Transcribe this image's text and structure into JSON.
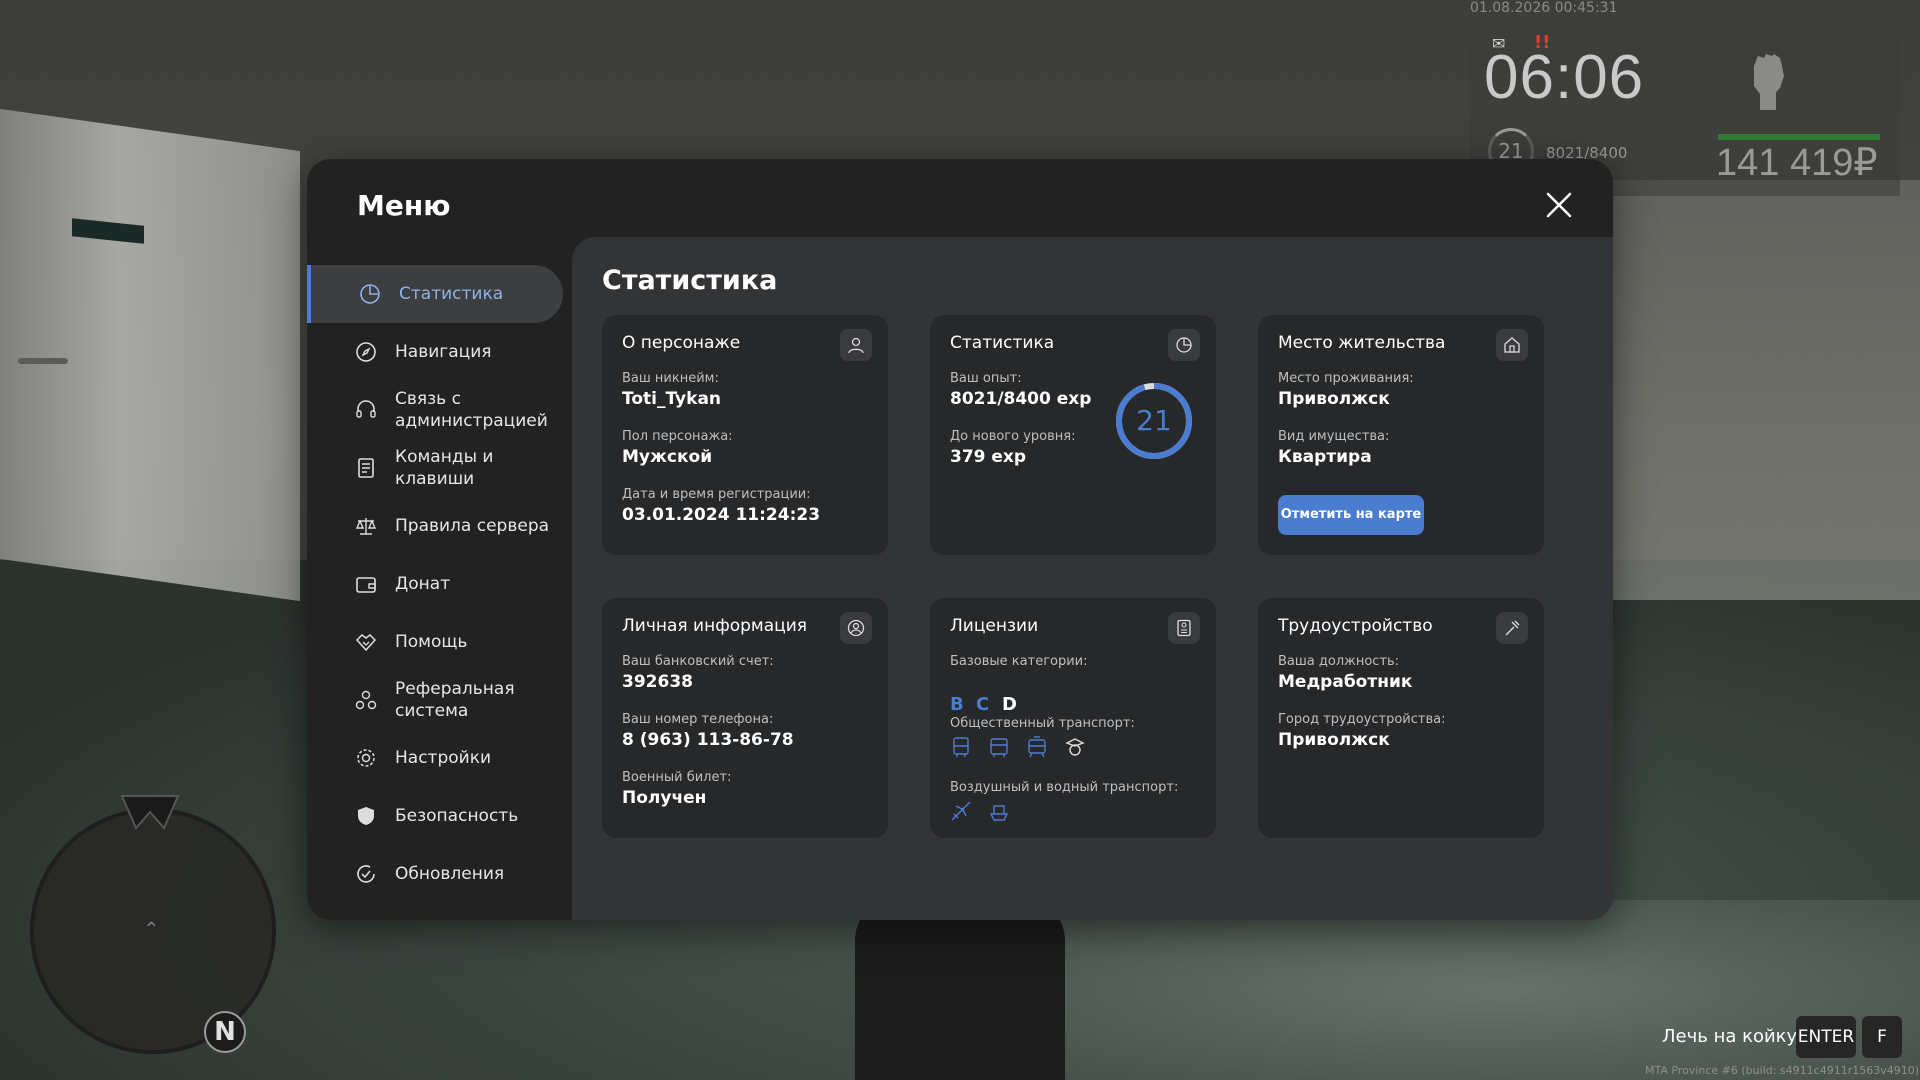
{
  "hud": {
    "datetime": "01.08.2026 00:45:31",
    "time": "06:06",
    "level": "21",
    "exp": "8021/8400",
    "money": "141 419₽",
    "mail_icon": "mail-icon",
    "alert_icon": "alert-icon",
    "colors": {
      "health": "#2e7d32",
      "alert": "#e53935"
    }
  },
  "minimap": {
    "north_label": "N"
  },
  "prompt": {
    "text": "Лечь на койку",
    "key_enter": "ENTER",
    "key_f": "F"
  },
  "build": "MTA Province #6 (build: s4911c4911r1563v4910)",
  "menu": {
    "title": "Меню",
    "sidebar": [
      {
        "label": "Статистика",
        "icon": "pie-chart-icon",
        "active": true
      },
      {
        "label": "Навигация",
        "icon": "compass-icon"
      },
      {
        "label": "Связь с администрацией",
        "icon": "headset-icon"
      },
      {
        "label": "Команды и клавиши",
        "icon": "document-icon"
      },
      {
        "label": "Правила сервера",
        "icon": "scales-icon"
      },
      {
        "label": "Донат",
        "icon": "wallet-icon"
      },
      {
        "label": "Помощь",
        "icon": "handshake-icon"
      },
      {
        "label": "Реферальная система",
        "icon": "referral-icon"
      },
      {
        "label": "Настройки",
        "icon": "gear-icon"
      },
      {
        "label": "Безопасность",
        "icon": "shield-icon"
      },
      {
        "label": "Обновления",
        "icon": "refresh-check-icon"
      }
    ],
    "content": {
      "title": "Статистика",
      "about": {
        "title": "О персонаже",
        "nickname_label": "Ваш никнейм:",
        "nickname": "Toti_Tykan",
        "gender_label": "Пол персонажа:",
        "gender": "Мужской",
        "reg_label": "Дата и время регистрации:",
        "reg_date": "03.01.2024 11:24:23"
      },
      "stats": {
        "title": "Статистика",
        "exp_label": "Ваш опыт:",
        "exp": "8021/8400 exp",
        "next_label": "До нового уровня:",
        "next": "379 exp",
        "level": "21",
        "level_progress": 0.955
      },
      "residence": {
        "title": "Место жительства",
        "place_label": "Место проживания:",
        "place": "Приволжск",
        "property_label": "Вид имущества:",
        "property": "Квартира",
        "button": "Отметить на карте"
      },
      "personal": {
        "title": "Личная информация",
        "bank_label": "Ваш банковский счет:",
        "bank": "392638",
        "phone_label": "Ваш номер телефона:",
        "phone": "8 (963) 113-86-78",
        "military_label": "Военный билет:",
        "military": "Получен"
      },
      "licenses": {
        "title": "Лицензии",
        "basic_label": "Базовые категории:",
        "categories": [
          {
            "letter": "B",
            "color": "#4a7ccf"
          },
          {
            "letter": "C",
            "color": "#4a7ccf"
          },
          {
            "letter": "D",
            "color": "#ffffff"
          }
        ],
        "public_label": "Общественный транспорт:",
        "air_label": "Воздушный и водный транспорт:"
      },
      "job": {
        "title": "Трудоустройство",
        "position_label": "Ваша должность:",
        "position": "Медработник",
        "city_label": "Город трудоустройства:",
        "city": "Приволжск"
      }
    }
  },
  "colors": {
    "accent": "#4a7ccf",
    "panel": "#222222",
    "content": "#333436",
    "card": "#27282a"
  }
}
